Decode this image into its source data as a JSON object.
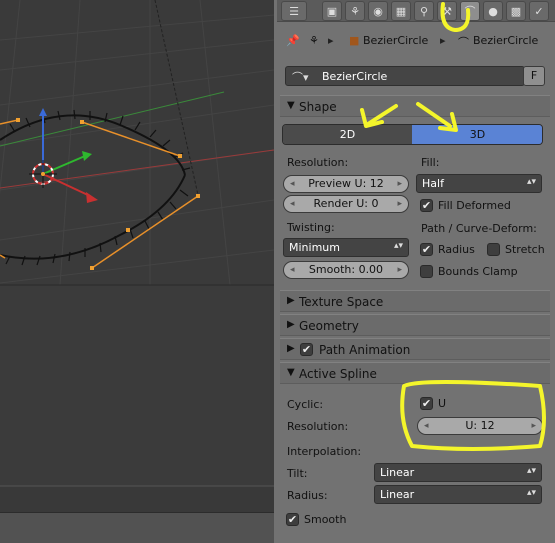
{
  "breadcrumb": {
    "object_name": "BezierCircle",
    "data_name": "BezierCircle"
  },
  "datablock": {
    "name": "BezierCircle",
    "fake_user": "F"
  },
  "shape": {
    "title": "Shape",
    "mode_2d": "2D",
    "mode_3d": "3D",
    "active_mode": "3D",
    "resolution_label": "Resolution:",
    "preview_u": "Preview U: 12",
    "render_u": "Render U: 0",
    "fill_label": "Fill:",
    "fill_value": "Half",
    "fill_deformed": "Fill Deformed",
    "twisting_label": "Twisting:",
    "twisting_value": "Minimum",
    "smooth": "Smooth: 0.00",
    "path_deform_label": "Path / Curve-Deform:",
    "radius": "Radius",
    "stretch": "Stretch",
    "bounds_clamp": "Bounds Clamp"
  },
  "panels": {
    "texture_space": "Texture Space",
    "geometry": "Geometry",
    "path_animation": "Path Animation",
    "active_spline": "Active Spline"
  },
  "active_spline": {
    "cyclic_label": "Cyclic:",
    "cyclic_u": "U",
    "resolution_label": "Resolution:",
    "resolution_u": "U: 12",
    "interpolation_label": "Interpolation:",
    "tilt_label": "Tilt:",
    "tilt_value": "Linear",
    "radius_label": "Radius:",
    "radius_value": "Linear",
    "smooth": "Smooth"
  },
  "colors": {
    "panel_bg": "#727272",
    "viewport_bg": "#393939",
    "active_toggle": "#5a83d5",
    "annotation": "#f4f52b",
    "curve_handle": "#f0a030"
  },
  "icons": [
    "render-icon",
    "scene-icon",
    "world-icon",
    "object-icon",
    "constraints-icon",
    "curve-data-icon",
    "material-icon",
    "texture-icon",
    "pin-icon"
  ]
}
